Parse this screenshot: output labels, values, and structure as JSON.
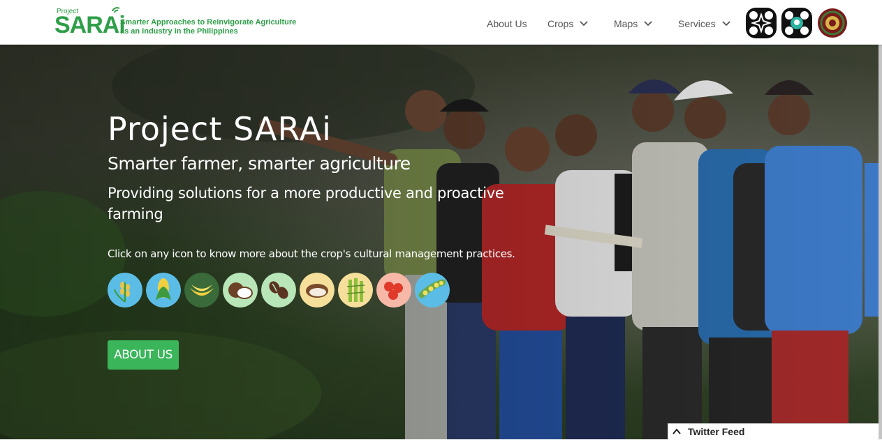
{
  "header": {
    "logo": {
      "project": "Project",
      "name": "SARAi",
      "tagline_1": "Smarter Approaches to Reinvigorate Agriculture",
      "tagline_2": "as an Industry in the Philippines"
    },
    "nav": [
      {
        "label": "About Us",
        "dropdown": false
      },
      {
        "label": "Crops",
        "dropdown": true
      },
      {
        "label": "Maps",
        "dropdown": true
      },
      {
        "label": "Services",
        "dropdown": true
      }
    ],
    "partner_logos": [
      "dost-pcaarrd-logo",
      "dost-logo",
      "up-seal-logo"
    ]
  },
  "hero": {
    "title": "Project SARAi",
    "subtitle": "Smarter farmer, smarter agriculture",
    "description": "Providing solutions for a more productive and proactive farming",
    "instruction": "Click on any icon to know more about the crop's cultural management practices.",
    "crops": [
      {
        "icon": "rice-icon",
        "bg": "#5bbde6"
      },
      {
        "icon": "corn-icon",
        "bg": "#5bbde6"
      },
      {
        "icon": "banana-icon",
        "bg": "#3a6a3a"
      },
      {
        "icon": "coconut-icon",
        "bg": "#b8e6b8"
      },
      {
        "icon": "coffee-icon",
        "bg": "#b8e6b8"
      },
      {
        "icon": "cacao-icon",
        "bg": "#f5df9a"
      },
      {
        "icon": "sugarcane-icon",
        "bg": "#f5df9a"
      },
      {
        "icon": "tomato-icon",
        "bg": "#f7b8a8"
      },
      {
        "icon": "soybean-icon",
        "bg": "#5bbde6"
      }
    ],
    "cta_label": "ABOUT US"
  },
  "twitter_feed": {
    "label": "Twitter Feed"
  },
  "colors": {
    "brand_green": "#2e9e48",
    "button_green": "#3ab55a"
  }
}
